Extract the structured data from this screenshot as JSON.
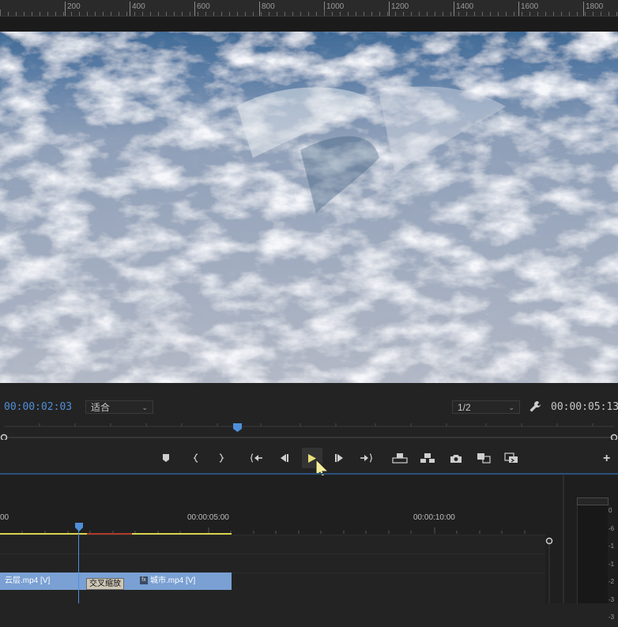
{
  "ruler": {
    "labels": [
      "200",
      "400",
      "600",
      "800",
      "1000",
      "1200",
      "1400",
      "1600",
      "1800"
    ]
  },
  "monitor": {
    "current_timecode": "00:00:02:03",
    "zoom_select": "适合",
    "resolution_select": "1/2",
    "duration_timecode": "00:00:05:13",
    "controls": [
      {
        "name": "add-marker",
        "icon": "marker-icon"
      },
      {
        "name": "mark-in",
        "icon": "mark-in-icon"
      },
      {
        "name": "mark-out",
        "icon": "mark-out-icon"
      },
      {
        "name": "go-to-in",
        "icon": "go-to-in-icon"
      },
      {
        "name": "step-back",
        "icon": "step-back-icon"
      },
      {
        "name": "play",
        "icon": "play-icon"
      },
      {
        "name": "step-forward",
        "icon": "step-forward-icon"
      },
      {
        "name": "go-to-out",
        "icon": "go-to-out-icon"
      },
      {
        "name": "lift",
        "icon": "lift-icon"
      },
      {
        "name": "extract",
        "icon": "extract-icon"
      },
      {
        "name": "export-frame",
        "icon": "camera-icon"
      },
      {
        "name": "compare",
        "icon": "compare-icon"
      },
      {
        "name": "proxy",
        "icon": "proxy-icon"
      }
    ],
    "add_button": "+"
  },
  "timeline": {
    "time_labels": [
      "00",
      "00:00:05:00",
      "00:00:10:00"
    ],
    "clips": [
      {
        "label": "云层.mp4 [V]",
        "color": "#7aa0d4"
      },
      {
        "label": "城市.mp4 [V]",
        "color": "#7aa0d4"
      }
    ],
    "transition_label": "交叉缩放",
    "fx_badge": "fx"
  },
  "meter": {
    "ticks": [
      "0",
      "-6",
      "-1",
      "-1",
      "-2",
      "-3",
      "-3"
    ]
  },
  "colors": {
    "accent": "#4f8fd8",
    "playhead": "#4f8fd8",
    "render_bar": "#d8d34a",
    "clip": "#7aa0d4"
  }
}
